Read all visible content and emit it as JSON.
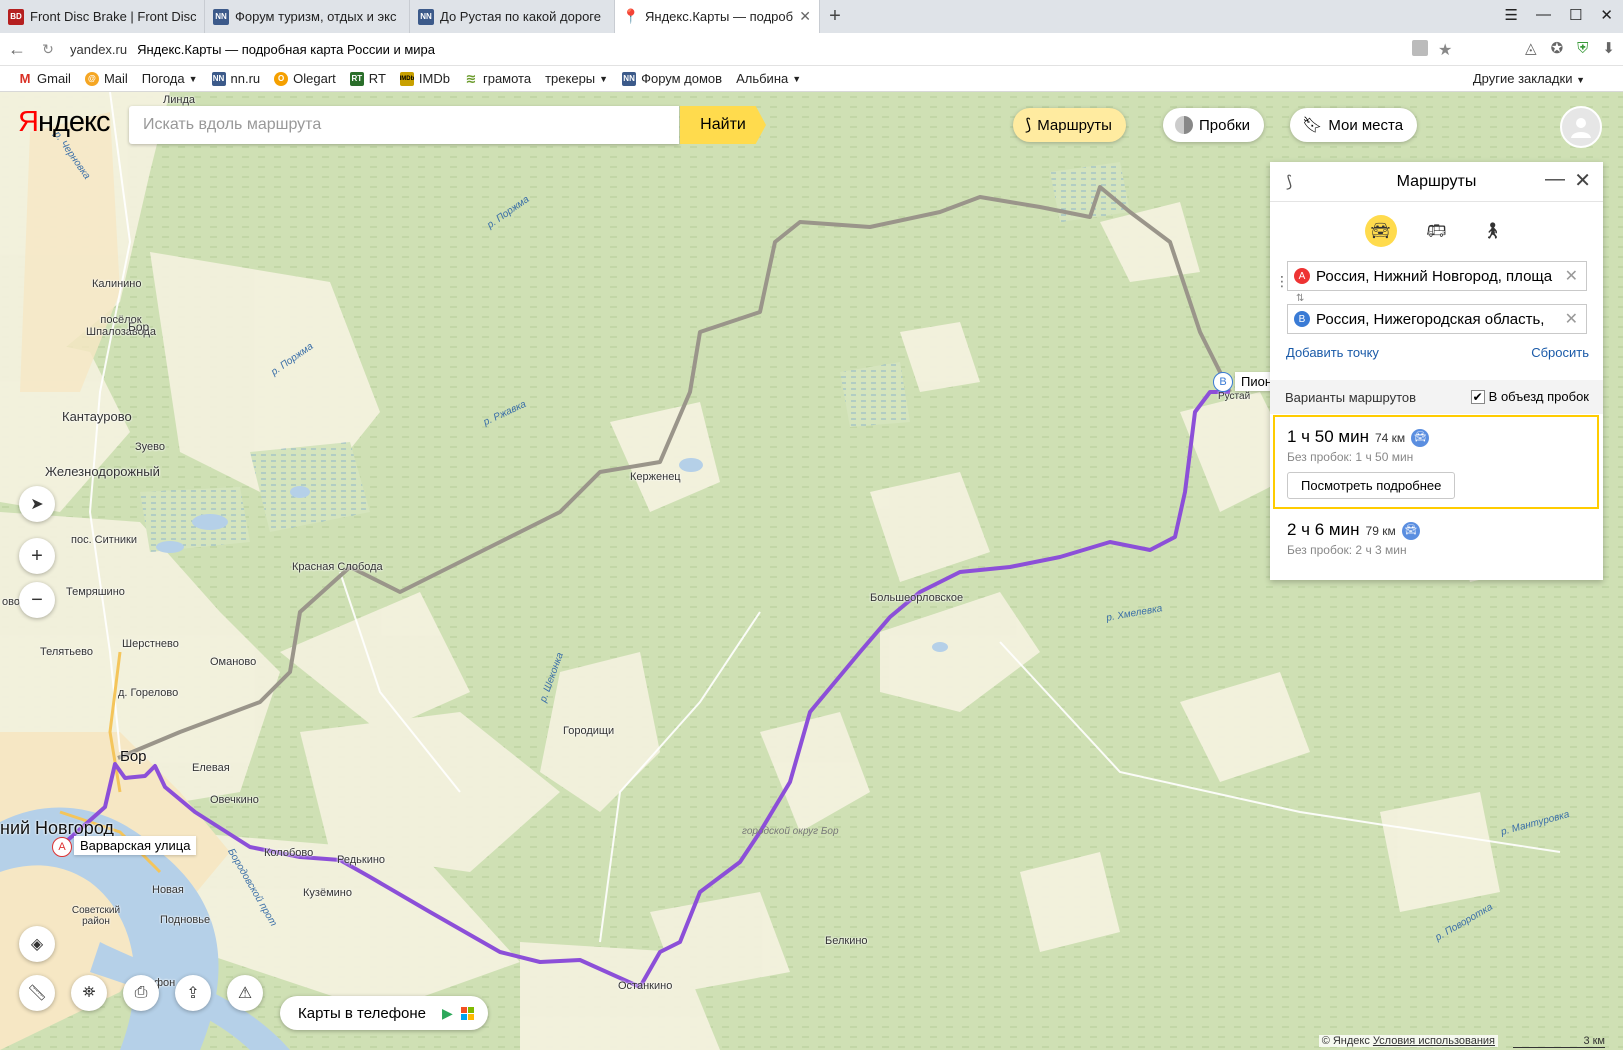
{
  "browser": {
    "tabs": [
      {
        "title": "Front Disc Brake | Front Disc",
        "favicon": "BD",
        "favicon_color": "#b51f1f",
        "active": false
      },
      {
        "title": "Форум туризм, отдых и экс",
        "favicon": "NN",
        "favicon_color": "#3c5a8a",
        "active": false
      },
      {
        "title": "До Рустая по какой дороге",
        "favicon": "NN",
        "favicon_color": "#3c5a8a",
        "active": false
      },
      {
        "title": "Яндекс.Карты — подроб",
        "favicon": "pin",
        "favicon_color": "#e32",
        "active": true
      }
    ],
    "domain": "yandex.ru",
    "page_title": "Яндекс.Карты — подробная карта России и мира",
    "bookmarks": [
      {
        "label": "Gmail",
        "icon": "M",
        "color": "#d93025"
      },
      {
        "label": "Mail",
        "icon": "@",
        "color": "#f5a623"
      },
      {
        "label": "Погода",
        "icon": "",
        "color": "",
        "dropdown": true
      },
      {
        "label": "nn.ru",
        "icon": "NN",
        "color": "#3c5a8a"
      },
      {
        "label": "Olegart",
        "icon": "O",
        "color": "#f5a000"
      },
      {
        "label": "RT",
        "icon": "RT",
        "color": "#2a6e2a"
      },
      {
        "label": "IMDb",
        "icon": "IMDb",
        "color": "#c8a000"
      },
      {
        "label": "грамота",
        "icon": "≋",
        "color": "#6a9a2a"
      },
      {
        "label": "трекеры",
        "icon": "",
        "color": "",
        "dropdown": true
      },
      {
        "label": "Форум домов",
        "icon": "NN",
        "color": "#3c5a8a"
      },
      {
        "label": "Альбина",
        "icon": "",
        "color": "",
        "dropdown": true
      }
    ],
    "other_bookmarks": "Другие закладки"
  },
  "map": {
    "logo_part1": "Я",
    "logo_part2": "ндекс",
    "search_placeholder": "Искать вдоль маршрута",
    "find_button": "Найти",
    "routes_button": "Маршруты",
    "traffic_button": "Пробки",
    "my_places_button": "Мои места",
    "mobile_banner": "Карты в телефоне",
    "copyright": "© Яндекс",
    "terms": "Условия использования",
    "scale": "3 км",
    "marker_a": "А",
    "marker_a_label": "Варварская улица",
    "marker_b": "B",
    "marker_b_label": "Пионе",
    "places": [
      {
        "name": "Линда"
      },
      {
        "name": "Калинино"
      },
      {
        "name": "посёлок Шпалозавода"
      },
      {
        "name": "Бор"
      },
      {
        "name": "Кантаурово"
      },
      {
        "name": "Зуево"
      },
      {
        "name": "Железнодорожный"
      },
      {
        "name": "пос. Ситники"
      },
      {
        "name": "Темряшино"
      },
      {
        "name": "Телятьево"
      },
      {
        "name": "Шерстнево"
      },
      {
        "name": "Красная Слобода"
      },
      {
        "name": "Оманово"
      },
      {
        "name": "д. Горелово"
      },
      {
        "name": "Бор"
      },
      {
        "name": "Елевая"
      },
      {
        "name": "Овечкино"
      },
      {
        "name": "ний Новгород"
      },
      {
        "name": "Колобово"
      },
      {
        "name": "Редькино"
      },
      {
        "name": "Кузёмино"
      },
      {
        "name": "Новая"
      },
      {
        "name": "Советский район"
      },
      {
        "name": "Подновье"
      },
      {
        "name": "Останкино"
      },
      {
        "name": "Белкино"
      },
      {
        "name": "Городищи"
      },
      {
        "name": "Большеорловское"
      },
      {
        "name": "Керженец"
      },
      {
        "name": "городской округ Бор"
      },
      {
        "name": "Рустай"
      },
      {
        "name": "фон"
      },
      {
        "name": "ово"
      }
    ],
    "rivers": [
      {
        "name": "р. Черновка"
      },
      {
        "name": "р. Поржма"
      },
      {
        "name": "р. Поржма"
      },
      {
        "name": "р. Ржавка"
      },
      {
        "name": "р. Шеконка"
      },
      {
        "name": "р. Хмелевка"
      },
      {
        "name": "р. Мантуровка"
      },
      {
        "name": "р. Поворотка"
      },
      {
        "name": "Бородовской прот"
      }
    ]
  },
  "routes_panel": {
    "title": "Маршруты",
    "from_text": "Россия, Нижний Новгород, площа",
    "to_text": "Россия, Нижегородская область, ",
    "from_badge": "А",
    "to_badge": "B",
    "add_point": "Добавить точку",
    "reset": "Сбросить",
    "variants_title": "Варианты маршрутов",
    "avoid_traffic": "В объезд пробок",
    "avoid_traffic_checked": true,
    "variants": [
      {
        "time": "1 ч 50 мин",
        "distance": "74 км",
        "no_traffic": "Без пробок: 1 ч 50 мин",
        "details_button": "Посмотреть подробнее",
        "selected": true
      },
      {
        "time": "2 ч 6 мин",
        "distance": "79 км",
        "no_traffic": "Без пробок: 2 ч 3 мин",
        "selected": false
      }
    ]
  },
  "colors": {
    "route_primary": "#8c4fd8",
    "route_alt": "#9a958a",
    "yandex_yellow": "#ffdb4d",
    "forest": "#cfe0b4",
    "field": "#f3f1de"
  }
}
